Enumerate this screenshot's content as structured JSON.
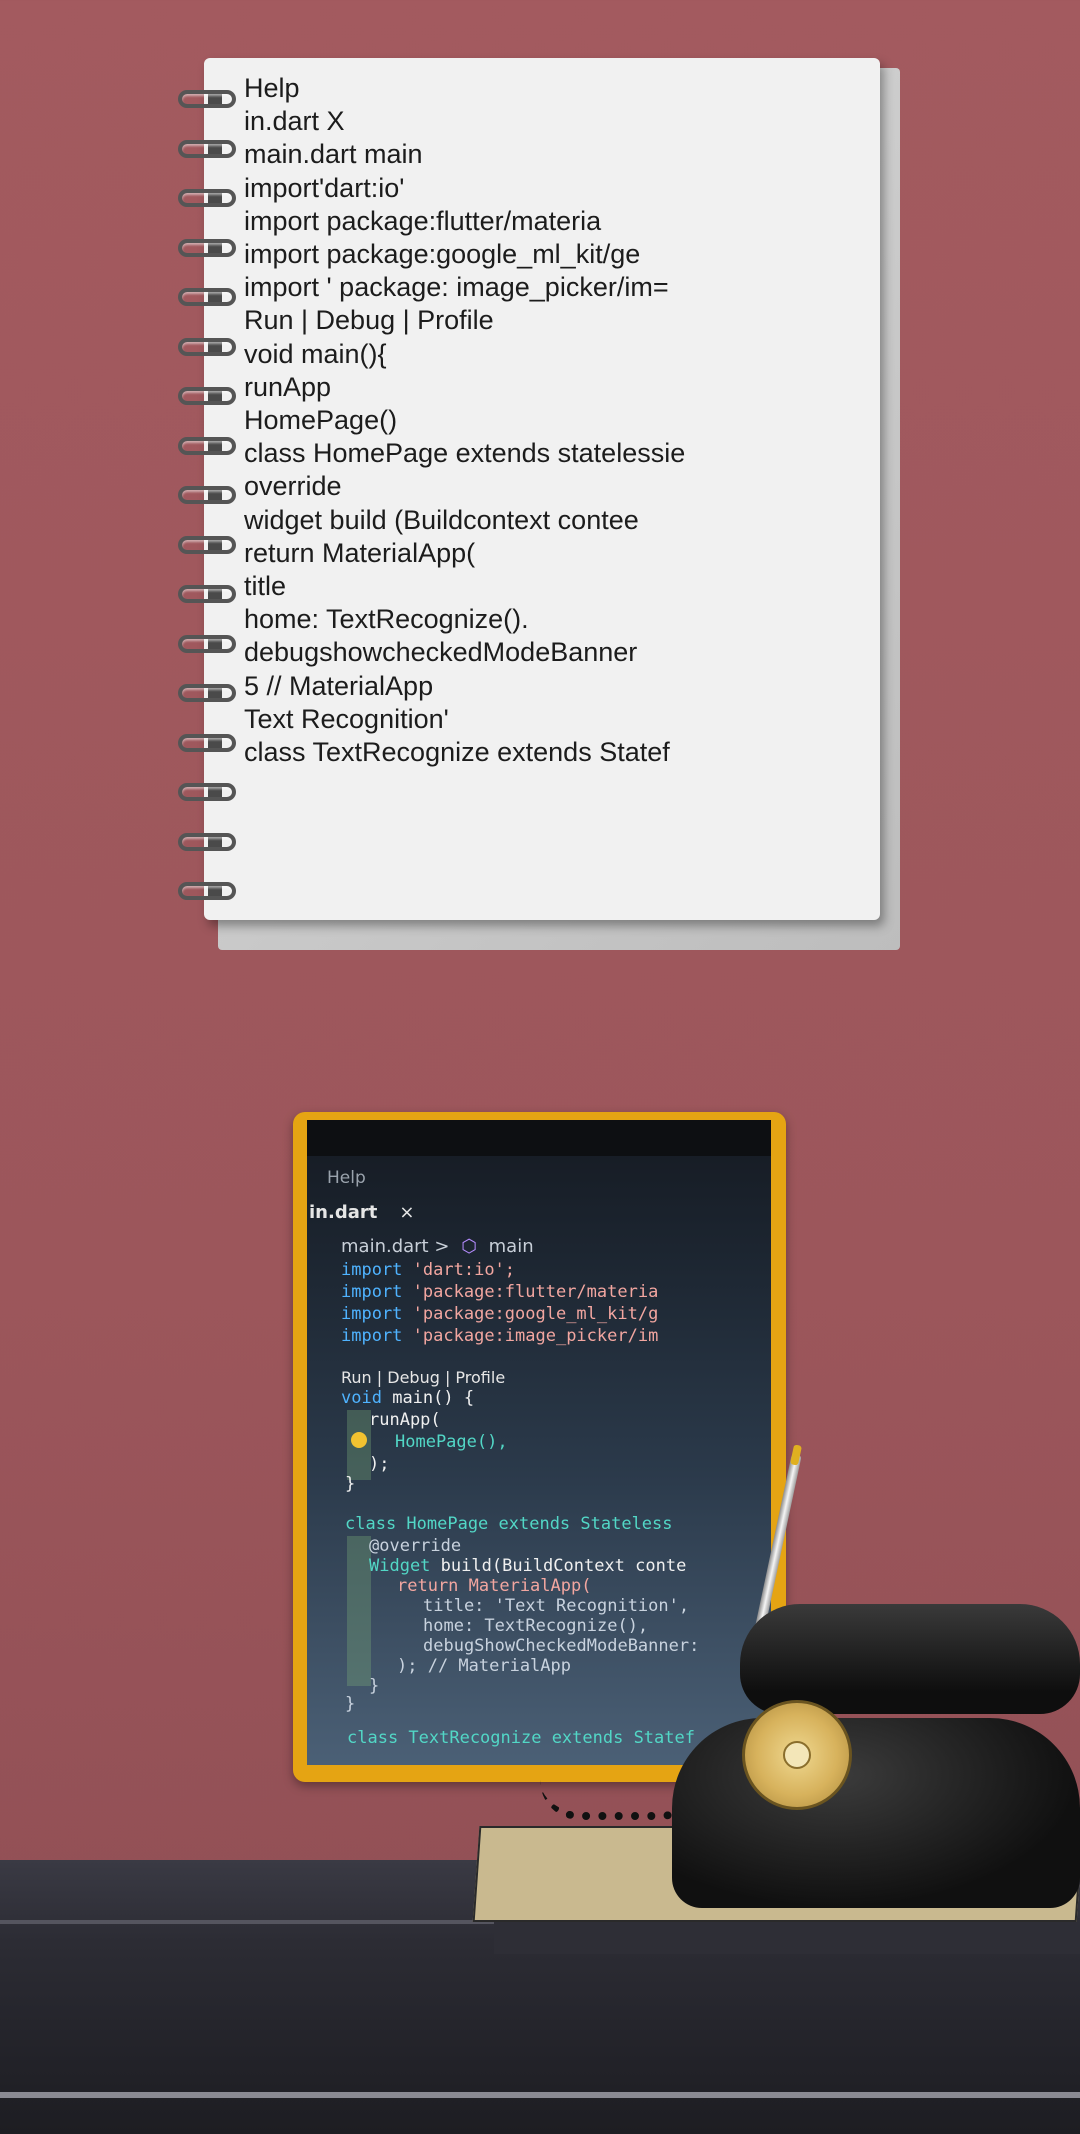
{
  "notebook": {
    "lines": [
      "Help",
      "in.dart X",
      "main.dart main",
      "import'dart:io'",
      "import package:flutter/materia",
      "import package:google_ml_kit/ge",
      "import ' package: image_picker/im=",
      "Run | Debug | Profile",
      "void main(){",
      "runApp",
      "HomePage()",
      "class HomePage extends statelessie",
      "override",
      "widget build (Buildcontext contee",
      "return MaterialApp(",
      "title",
      "home: TextRecognize().",
      "debugshowcheckedModeBanner",
      "5 // MaterialApp",
      "Text Recognition'",
      "class TextRecognize extends Statef"
    ],
    "ring_count": 17
  },
  "photo": {
    "menu": "Help",
    "tab": "in.dart",
    "tab_close": "×",
    "crumb_file": "main.dart",
    "crumb_sep": ">",
    "crumb_symbol": "main",
    "imports": [
      {
        "kw": "import",
        "str": "'dart:io';"
      },
      {
        "kw": "import",
        "str": "'package:flutter/materia"
      },
      {
        "kw": "import",
        "str": "'package:google_ml_kit/g"
      },
      {
        "kw": "import",
        "str": "'package:image_picker/im"
      }
    ],
    "run_links": "Run | Debug | Profile",
    "void_kw": "void",
    "main_sig": "main() {",
    "run_app": "runApp(",
    "home_page": "HomePage(),",
    "close_paren": ");",
    "close_brace": "}",
    "class_line": "class HomePage extends Stateless",
    "override": "@override",
    "widget_kw": "Widget",
    "build_sig": "build(BuildContext conte",
    "return_line": "return MaterialApp(",
    "title_line": "title: 'Text Recognition',",
    "home_line": "home: TextRecognize(),",
    "debug_line": "debugShowCheckedModeBanner:",
    "end_app": "); // MaterialApp",
    "brace2": "}",
    "brace3": "}",
    "last_line": "class TextRecognize extends Statef"
  }
}
